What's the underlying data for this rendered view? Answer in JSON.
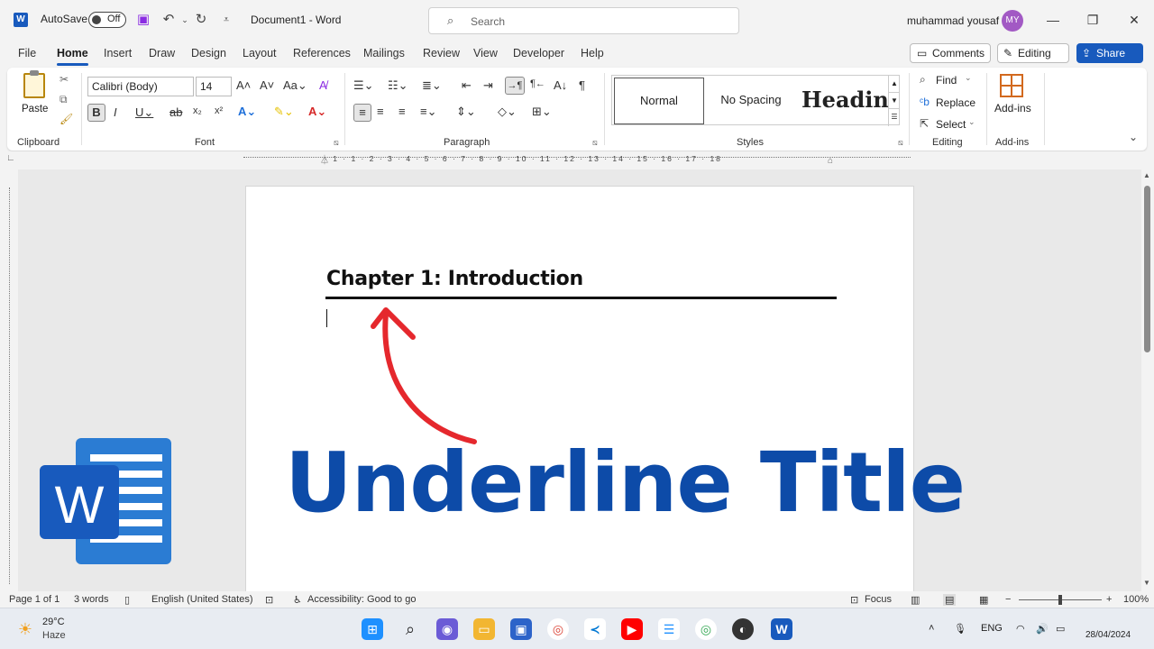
{
  "titlebar": {
    "autosave_label": "AutoSave",
    "autosave_state": "Off",
    "document_title": "Document1  -  Word",
    "search_placeholder": "Search",
    "user_name": "muhammad yousaf",
    "user_initials": "MY"
  },
  "menu": {
    "tabs": [
      "File",
      "Home",
      "Insert",
      "Draw",
      "Design",
      "Layout",
      "References",
      "Mailings",
      "Review",
      "View",
      "Developer",
      "Help"
    ],
    "active_tab": "Home",
    "comments_label": "Comments",
    "editing_label": "Editing",
    "share_label": "Share"
  },
  "ribbon": {
    "clipboard": {
      "paste_label": "Paste",
      "group_label": "Clipboard"
    },
    "font": {
      "font_name": "Calibri (Body)",
      "font_size": "14",
      "group_label": "Font"
    },
    "paragraph": {
      "group_label": "Paragraph"
    },
    "styles": {
      "normal": "Normal",
      "no_spacing": "No Spacing",
      "heading": "Heading",
      "group_label": "Styles"
    },
    "editing": {
      "find": "Find",
      "replace": "Replace",
      "select": "Select",
      "group_label": "Editing"
    },
    "addins": {
      "label": "Add-ins",
      "group_label": "Add-ins"
    }
  },
  "ruler": {
    "numbers": "· 1 · 1 · 2 · 3 · 4 · 5 · 6 · 7 · 8 · 9 · 10 · 11 · 12 · 13 · 14 · 15 · 16 · 17 · 18"
  },
  "document": {
    "heading": "Chapter 1: Introduction"
  },
  "overlay": {
    "title": "Underline Title",
    "logo_letter": "W",
    "title_color": "#0d4ba8",
    "arrow_color": "#e5282d"
  },
  "statusbar": {
    "page": "Page 1 of 1",
    "words": "3 words",
    "language": "English (United States)",
    "accessibility": "Accessibility: Good to go",
    "focus": "Focus",
    "zoom": "100%"
  },
  "taskbar": {
    "weather_temp": "29°C",
    "weather_desc": "Haze",
    "lang": "ENG",
    "date": "28/04/2024"
  },
  "colors": {
    "accent": "#185abd"
  }
}
